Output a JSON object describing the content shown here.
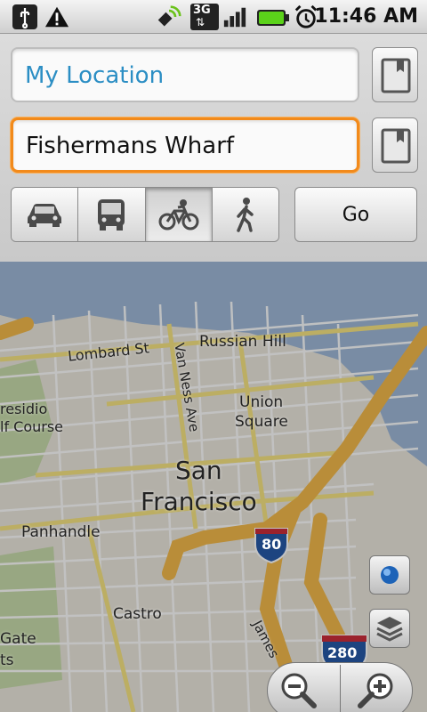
{
  "status_bar": {
    "time": "11:46 AM",
    "network_label": "3G"
  },
  "directions": {
    "start": {
      "value": "My Location",
      "color": "#2b8ec4"
    },
    "end": {
      "value": "Fishermans Wharf"
    },
    "go_label": "Go",
    "modes": [
      {
        "name": "car",
        "selected": false
      },
      {
        "name": "transit",
        "selected": false
      },
      {
        "name": "bicycle",
        "selected": true
      },
      {
        "name": "walking",
        "selected": false
      }
    ]
  },
  "map": {
    "labels": {
      "lombard": "Lombard St",
      "van_ness": "Van Ness Ave",
      "russian_hill": "Russian Hill",
      "union_square_1": "Union",
      "union_square_2": "Square",
      "presidio_1": "residio",
      "presidio_2": "lf Course",
      "sf_1": "San",
      "sf_2": "Francisco",
      "panhandle": "Panhandle",
      "castro": "Castro",
      "gate_1": "Gate",
      "gate_2": "ts",
      "james": "James",
      "i80": "80",
      "i280": "280"
    }
  },
  "colors": {
    "accent_focus": "#f28a1b",
    "highway": "#f2b540",
    "arterial": "#f6e27a"
  }
}
